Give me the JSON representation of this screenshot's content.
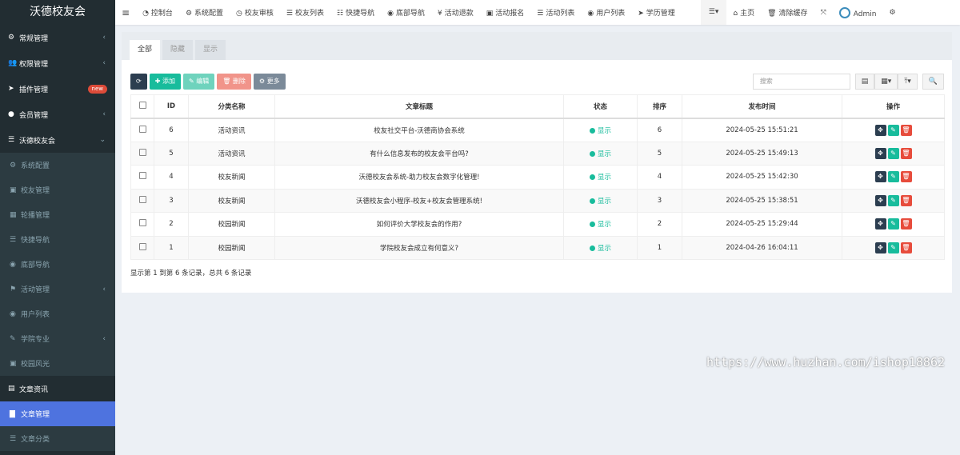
{
  "app_title": "沃德校友会",
  "sidebar": {
    "items": [
      {
        "label": "常规管理",
        "icon": "cogs-icon",
        "g": "⚙",
        "chev": true
      },
      {
        "label": "权限管理",
        "icon": "users-icon",
        "g": "👥",
        "chev": true
      },
      {
        "label": "插件管理",
        "icon": "rocket-icon",
        "g": "➤",
        "badge": "new"
      },
      {
        "label": "会员管理",
        "icon": "user-circle-icon",
        "g": "●",
        "chev": true
      },
      {
        "label": "沃德校友会",
        "icon": "list-icon",
        "g": "☰",
        "chev": true,
        "open": true
      }
    ],
    "sub1": [
      {
        "label": "系统配置",
        "g": "⚙"
      },
      {
        "label": "校友管理",
        "g": "▣"
      },
      {
        "label": "轮播管理",
        "g": "▦"
      },
      {
        "label": "快捷导航",
        "g": "☰"
      },
      {
        "label": "底部导航",
        "g": "◉"
      },
      {
        "label": "活动管理",
        "g": "⚑",
        "chev": true
      },
      {
        "label": "用户列表",
        "g": "◉"
      },
      {
        "label": "学院专业",
        "g": "✎",
        "chev": true
      },
      {
        "label": "校园风光",
        "g": "▣"
      }
    ],
    "group2": {
      "label": "文章资讯",
      "g": "▤"
    },
    "sub2": [
      {
        "label": "文章管理",
        "g": "▇",
        "active": true
      },
      {
        "label": "文章分类",
        "g": "☰"
      }
    ]
  },
  "topnav": [
    {
      "label": "控制台",
      "g": "◔"
    },
    {
      "label": "系统配置",
      "g": "⚙"
    },
    {
      "label": "校友审核",
      "g": "◷"
    },
    {
      "label": "校友列表",
      "g": "☰"
    },
    {
      "label": "快捷导航",
      "g": "☷"
    },
    {
      "label": "底部导航",
      "g": "◉"
    },
    {
      "label": "活动退款",
      "g": "¥"
    },
    {
      "label": "活动报名",
      "g": "▣"
    },
    {
      "label": "活动列表",
      "g": "☰"
    },
    {
      "label": "用户列表",
      "g": "◉"
    },
    {
      "label": "学历管理",
      "g": "➤"
    }
  ],
  "topright": {
    "home": "主页",
    "clear_cache": "清除缓存",
    "user": "Admin"
  },
  "tabs": [
    "全部",
    "隐藏",
    "显示"
  ],
  "toolbar": {
    "add": "添加",
    "edit": "编辑",
    "delete": "删除",
    "more": "更多",
    "search_placeholder": "搜索"
  },
  "colors": {
    "sidebar": "#222d32",
    "active": "#4e73df",
    "primary": "#18bc9c",
    "danger": "#e74c3c",
    "dark": "#2c3e50"
  },
  "table": {
    "headers": [
      "ID",
      "分类名称",
      "文章标题",
      "状态",
      "排序",
      "发布时间",
      "操作"
    ],
    "rows": [
      {
        "id": "6",
        "cat": "活动资讯",
        "title": "校友社交平台-沃德商协会系统",
        "status": "显示",
        "sort": "6",
        "time": "2024-05-25 15:51:21"
      },
      {
        "id": "5",
        "cat": "活动资讯",
        "title": "有什么信息发布的校友会平台吗?",
        "status": "显示",
        "sort": "5",
        "time": "2024-05-25 15:49:13"
      },
      {
        "id": "4",
        "cat": "校友新闻",
        "title": "沃德校友会系统-助力校友会数字化管理!",
        "status": "显示",
        "sort": "4",
        "time": "2024-05-25 15:42:30"
      },
      {
        "id": "3",
        "cat": "校友新闻",
        "title": "沃德校友会小程序-校友+校友会管理系统!",
        "status": "显示",
        "sort": "3",
        "time": "2024-05-25 15:38:51"
      },
      {
        "id": "2",
        "cat": "校园新闻",
        "title": "如何评价大学校友会的作用?",
        "status": "显示",
        "sort": "2",
        "time": "2024-05-25 15:29:44"
      },
      {
        "id": "1",
        "cat": "校园新闻",
        "title": "学院校友会成立有何意义?",
        "status": "显示",
        "sort": "1",
        "time": "2024-04-26 16:04:11"
      }
    ]
  },
  "footer": "显示第 1 到第 6 条记录，总共 6 条记录",
  "watermark": "https://www.huzhan.com/ishop18862"
}
